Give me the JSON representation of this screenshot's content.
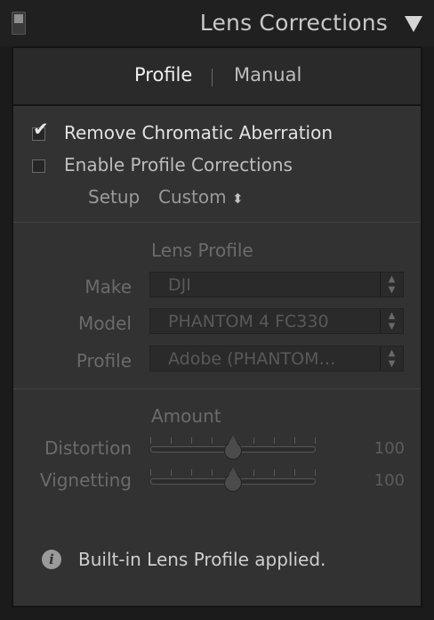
{
  "header": {
    "title": "Lens Corrections"
  },
  "tabs": {
    "profile_label": "Profile",
    "manual_label": "Manual"
  },
  "options": {
    "remove_ca_label": "Remove Chromatic Aberration",
    "remove_ca_checked": true,
    "enable_profile_label": "Enable Profile Corrections",
    "enable_profile_checked": false,
    "setup_label": "Setup",
    "setup_value": "Custom",
    "setup_arrow": "⬍"
  },
  "lens_profile": {
    "heading": "Lens Profile",
    "make_label": "Make",
    "make_value": "DJI",
    "model_label": "Model",
    "model_value": "PHANTOM 4 FC330",
    "profile_label": "Profile",
    "profile_value": "Adobe (PHANTOM…"
  },
  "amount": {
    "heading": "Amount",
    "distortion_label": "Distortion",
    "distortion_value": "100",
    "vignetting_label": "Vignetting",
    "vignetting_value": "100"
  },
  "status": {
    "message": "Built-in Lens Profile applied."
  },
  "colors": {
    "panel_bg": "#323232",
    "header_bg": "#202020",
    "active_text": "#f0f0f0",
    "disabled_text": "#6b6b6b"
  }
}
